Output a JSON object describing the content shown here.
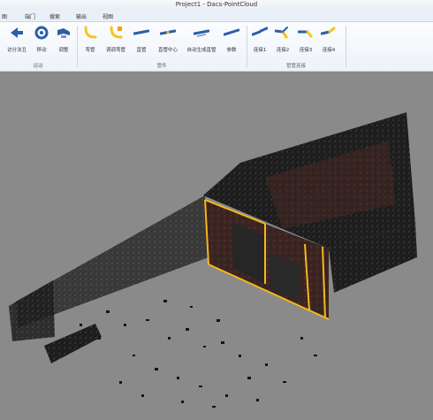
{
  "window": {
    "title": "Project1 - Dacs-PointCloud"
  },
  "menu": {
    "items": [
      "图",
      "端门",
      "搜索",
      "输出",
      "视图"
    ]
  },
  "ribbon": {
    "groups": [
      {
        "label": "运动",
        "buttons": [
          {
            "label": "访分法丑",
            "icon": "arrow-icon"
          },
          {
            "label": "移动",
            "icon": "circle-icon"
          },
          {
            "label": "调整",
            "icon": "tools-icon"
          }
        ]
      },
      {
        "label": "管件",
        "buttons": [
          {
            "label": "弯管",
            "icon": "bent-pipe-icon"
          },
          {
            "label": "调调弯管",
            "icon": "bent-pipe-icon"
          },
          {
            "label": "直管",
            "icon": "straight-pipe-icon"
          },
          {
            "label": "直管中心",
            "icon": "straight-pipe-icon"
          },
          {
            "label": "自动生成直管",
            "icon": "straight-pipe-icon"
          },
          {
            "label": "参数",
            "icon": "straight-pipe-icon"
          }
        ]
      },
      {
        "label": "管管连接",
        "buttons": [
          {
            "label": "连接1",
            "icon": "connect-icon"
          },
          {
            "label": "连接2",
            "icon": "connect-icon"
          },
          {
            "label": "连接3",
            "icon": "connect-icon"
          },
          {
            "label": "连接4",
            "icon": "connect-icon"
          }
        ]
      }
    ]
  },
  "colors": {
    "titlebar": "#eef2f8",
    "ribbon": "#f3f6fb",
    "viewport": "#8a8a8a",
    "accent_yellow": "#f5b81a",
    "accent_blue": "#2b5fa8",
    "wall_red": "#5a2a22"
  }
}
